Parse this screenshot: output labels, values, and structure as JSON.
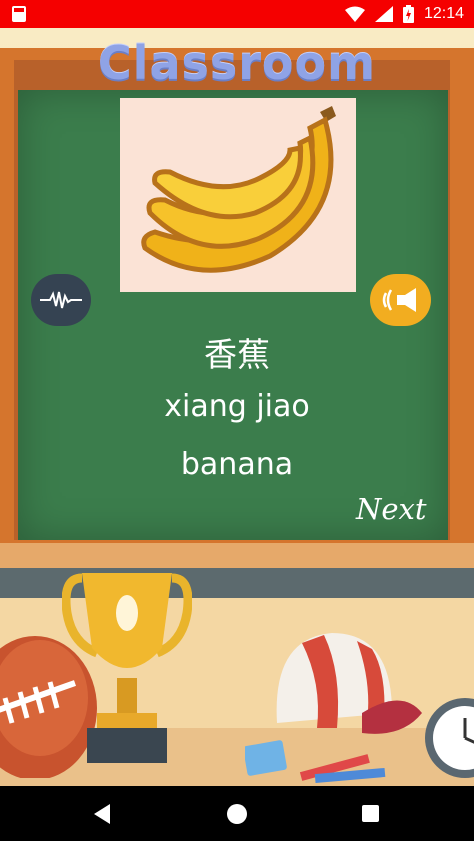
{
  "status_bar": {
    "time": "12:14",
    "icons": [
      "sd-card-icon",
      "wifi-icon",
      "signal-icon",
      "battery-icon"
    ]
  },
  "app": {
    "title": "Classroom"
  },
  "card": {
    "image": "banana-image",
    "hanzi": "香蕉",
    "pinyin": "xiang jiao",
    "english": "banana"
  },
  "controls": {
    "record_icon": "waveform-icon",
    "play_icon": "speaker-icon",
    "next_label": "Next"
  },
  "colors": {
    "status_bar": "#f50000",
    "board": "#3b7d4c",
    "record_button": "#354352",
    "play_button": "#f2ad20",
    "title": "#8fa3e6"
  },
  "nav_bar": {
    "icons": [
      "back-icon",
      "home-icon",
      "recents-icon"
    ]
  }
}
